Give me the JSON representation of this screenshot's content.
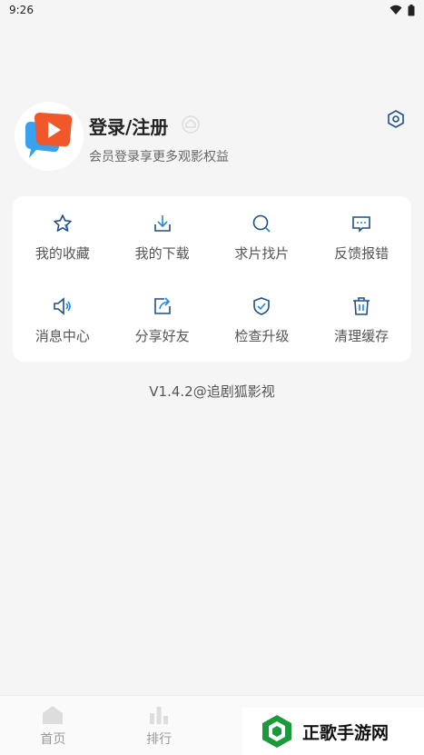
{
  "status_bar": {
    "time": "9:26"
  },
  "profile": {
    "title": "登录/注册",
    "subtitle": "会员登录享更多观影权益"
  },
  "menu": {
    "items": [
      {
        "label": "我的收藏",
        "icon": "star-icon"
      },
      {
        "label": "我的下载",
        "icon": "download-icon"
      },
      {
        "label": "求片找片",
        "icon": "search-icon"
      },
      {
        "label": "反馈报错",
        "icon": "feedback-icon"
      },
      {
        "label": "消息中心",
        "icon": "speaker-icon"
      },
      {
        "label": "分享好友",
        "icon": "share-icon"
      },
      {
        "label": "检查升级",
        "icon": "shield-check-icon"
      },
      {
        "label": "清理缓存",
        "icon": "trash-icon"
      }
    ]
  },
  "version": "V1.4.2@追剧狐影视",
  "tab_bar": {
    "tabs": [
      {
        "label": "首页"
      },
      {
        "label": "排行"
      },
      {
        "label": ""
      },
      {
        "label": ""
      }
    ]
  },
  "watermark": {
    "text": "正歌手游网"
  },
  "colors": {
    "accent": "#2a8fe6",
    "icon_blue": "#1e88e5",
    "logo_orange": "#f0572a"
  }
}
